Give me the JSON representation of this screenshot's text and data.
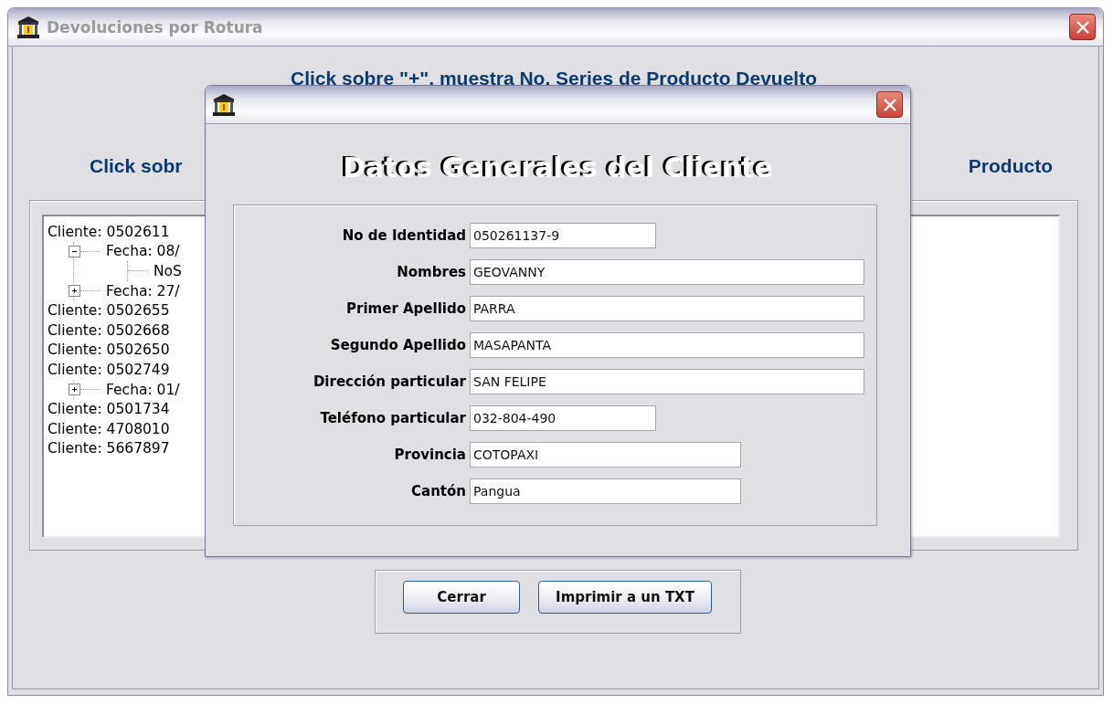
{
  "window": {
    "title": "Devoluciones por Rotura"
  },
  "heading_1": "Click sobre \"+\", muestra No. Series de Producto Devuelto",
  "heading_2_left": "Click sobr",
  "heading_2_right": "Producto",
  "tree": [
    {
      "text": "Cliente: 0502611",
      "children": [
        {
          "text": "Fecha: 08/",
          "expanded": true,
          "children": [
            {
              "text": "NoS"
            }
          ]
        },
        {
          "text": "Fecha: 27/",
          "expanded": false
        }
      ]
    },
    {
      "text": "Cliente: 0502655"
    },
    {
      "text": "Cliente: 0502668"
    },
    {
      "text": "Cliente: 0502650"
    },
    {
      "text": "Cliente: 0502749",
      "children": [
        {
          "text": "Fecha: 01/",
          "expanded": false
        }
      ]
    },
    {
      "text": "Cliente: 0501734"
    },
    {
      "text": "Cliente: 4708010"
    },
    {
      "text": "Cliente: 5667897"
    }
  ],
  "buttons": [
    "Cerrar",
    "Imprimir a un TXT"
  ],
  "dialog": {
    "heading": "Datos Generales del Cliente",
    "fields": [
      {
        "label": "No de Identidad",
        "value": "050261137-9",
        "kind": "short"
      },
      {
        "label": "Nombres",
        "value": "GEOVANNY",
        "kind": "long"
      },
      {
        "label": "Primer Apellido",
        "value": "PARRA",
        "kind": "long"
      },
      {
        "label": "Segundo Apellido",
        "value": "MASAPANTA",
        "kind": "long"
      },
      {
        "label": "Dirección particular",
        "value": "SAN FELIPE",
        "kind": "long"
      },
      {
        "label": "Teléfono particular",
        "value": "032-804-490",
        "kind": "short"
      },
      {
        "label": "Provincia",
        "value": "COTOPAXI",
        "kind": "medium"
      },
      {
        "label": "Cantón",
        "value": "Pangua",
        "kind": "medium"
      }
    ]
  }
}
